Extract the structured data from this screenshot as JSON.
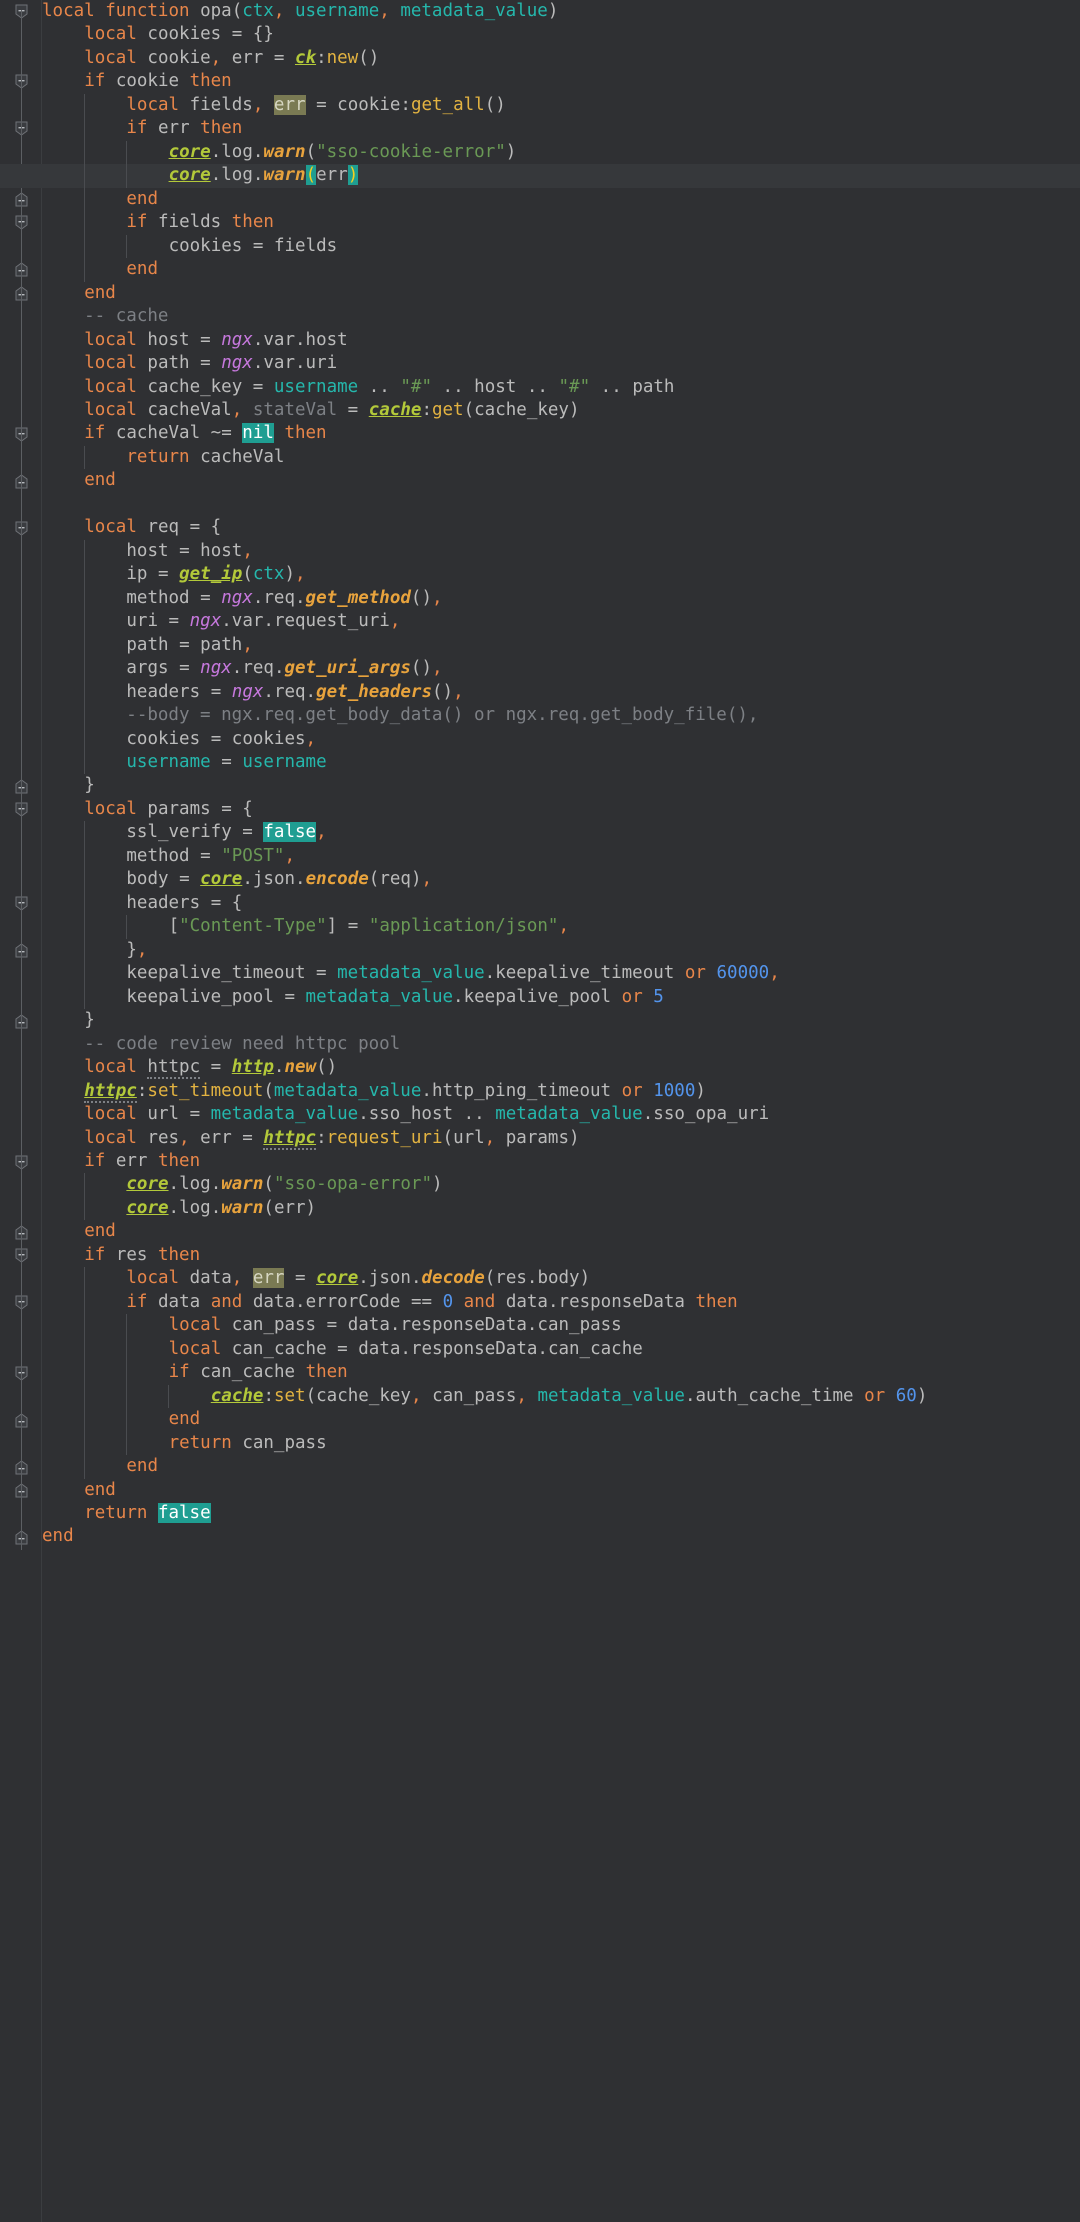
{
  "editor": {
    "language": "lua",
    "theme": "darcula",
    "background": "#2f3033",
    "gutter_background": "#2f3033",
    "default_text_color": "#bbbbbb",
    "cursor_line_color": "#36383b",
    "font_size_px": 17.5,
    "line_height_px": 23.48,
    "tab_width": 4
  },
  "colors": {
    "keyword": "#e8864a",
    "parameter": "#25b7ac",
    "global_italic": "#c678dd",
    "string": "#6a9955",
    "number": "#5394ec",
    "comment": "#7d8085",
    "unused_variable": "#7d8085",
    "method_call": "#e3b341",
    "library_function": "#e8a33d",
    "local_function": "#b3c93a",
    "search_highlight_bg": "#1f9e92",
    "write_usage_bg": "#7a7a53",
    "matching_brace_bg": "#1f9e92",
    "indent_guide": "#4a4c50",
    "fold_marker": "#5c5f63"
  },
  "highlights": {
    "search_term": "false",
    "occurrences": [
      "nil",
      "false"
    ],
    "write_usage_token": "err",
    "cursor_line_numbers": [
      7,
      40
    ]
  },
  "code_lines": [
    {
      "n": 1,
      "indent": 0,
      "fold": "start",
      "text": "local function opa(ctx, username, metadata_value)"
    },
    {
      "n": 2,
      "indent": 1,
      "text": "local cookies = {}"
    },
    {
      "n": 3,
      "indent": 1,
      "text": "local cookie, err = ck:new()"
    },
    {
      "n": 4,
      "indent": 1,
      "fold": "start",
      "text": "if cookie then"
    },
    {
      "n": 5,
      "indent": 2,
      "text": "local fields, err = cookie:get_all()"
    },
    {
      "n": 6,
      "indent": 2,
      "fold": "start",
      "text": "if err then"
    },
    {
      "n": 7,
      "indent": 3,
      "text": "core.log.warn(\"sso-cookie-error\")"
    },
    {
      "n": 8,
      "indent": 3,
      "text": "core.log.warn(err)",
      "cursor": true
    },
    {
      "n": 9,
      "indent": 2,
      "fold": "end",
      "text": "end"
    },
    {
      "n": 10,
      "indent": 2,
      "fold": "start",
      "text": "if fields then"
    },
    {
      "n": 11,
      "indent": 3,
      "text": "cookies = fields"
    },
    {
      "n": 12,
      "indent": 2,
      "fold": "end",
      "text": "end"
    },
    {
      "n": 13,
      "indent": 1,
      "fold": "end",
      "text": "end"
    },
    {
      "n": 14,
      "indent": 1,
      "text": "-- cache"
    },
    {
      "n": 15,
      "indent": 1,
      "text": "local host = ngx.var.host"
    },
    {
      "n": 16,
      "indent": 1,
      "text": "local path = ngx.var.uri"
    },
    {
      "n": 17,
      "indent": 1,
      "text": "local cache_key = username .. \"#\" .. host .. \"#\" .. path"
    },
    {
      "n": 18,
      "indent": 1,
      "text": "local cacheVal, stateVal = cache:get(cache_key)"
    },
    {
      "n": 19,
      "indent": 1,
      "fold": "start",
      "text": "if cacheVal ~= nil then"
    },
    {
      "n": 20,
      "indent": 2,
      "text": "return cacheVal"
    },
    {
      "n": 21,
      "indent": 1,
      "fold": "end",
      "text": "end"
    },
    {
      "n": 22,
      "indent": 0,
      "text": ""
    },
    {
      "n": 23,
      "indent": 1,
      "fold": "start",
      "text": "local req = {"
    },
    {
      "n": 24,
      "indent": 2,
      "text": "host = host,"
    },
    {
      "n": 25,
      "indent": 2,
      "text": "ip = get_ip(ctx),"
    },
    {
      "n": 26,
      "indent": 2,
      "text": "method = ngx.req.get_method(),"
    },
    {
      "n": 27,
      "indent": 2,
      "text": "uri = ngx.var.request_uri,"
    },
    {
      "n": 28,
      "indent": 2,
      "text": "path = path,"
    },
    {
      "n": 29,
      "indent": 2,
      "text": "args = ngx.req.get_uri_args(),"
    },
    {
      "n": 30,
      "indent": 2,
      "text": "headers = ngx.req.get_headers(),"
    },
    {
      "n": 31,
      "indent": 2,
      "text": "--body = ngx.req.get_body_data() or ngx.req.get_body_file(),"
    },
    {
      "n": 32,
      "indent": 2,
      "text": "cookies = cookies,"
    },
    {
      "n": 33,
      "indent": 2,
      "text": "username = username"
    },
    {
      "n": 34,
      "indent": 1,
      "fold": "end",
      "text": "}"
    },
    {
      "n": 35,
      "indent": 1,
      "fold": "start",
      "text": "local params = {"
    },
    {
      "n": 36,
      "indent": 2,
      "text": "ssl_verify = false,"
    },
    {
      "n": 37,
      "indent": 2,
      "text": "method = \"POST\","
    },
    {
      "n": 38,
      "indent": 2,
      "text": "body = core.json.encode(req),"
    },
    {
      "n": 39,
      "indent": 2,
      "fold": "start",
      "text": "headers = {"
    },
    {
      "n": 40,
      "indent": 3,
      "text": "[\"Content-Type\"] = \"application/json\","
    },
    {
      "n": 41,
      "indent": 2,
      "fold": "end",
      "text": "},"
    },
    {
      "n": 42,
      "indent": 2,
      "text": "keepalive_timeout = metadata_value.keepalive_timeout or 60000,"
    },
    {
      "n": 43,
      "indent": 2,
      "text": "keepalive_pool = metadata_value.keepalive_pool or 5"
    },
    {
      "n": 44,
      "indent": 1,
      "fold": "end",
      "text": "}"
    },
    {
      "n": 45,
      "indent": 1,
      "text": "-- code review need httpc pool"
    },
    {
      "n": 46,
      "indent": 1,
      "text": "local httpc = http.new()"
    },
    {
      "n": 47,
      "indent": 1,
      "text": "httpc:set_timeout(metadata_value.http_ping_timeout or 1000)"
    },
    {
      "n": 48,
      "indent": 1,
      "text": "local url = metadata_value.sso_host .. metadata_value.sso_opa_uri"
    },
    {
      "n": 49,
      "indent": 1,
      "text": "local res, err = httpc:request_uri(url, params)"
    },
    {
      "n": 50,
      "indent": 1,
      "fold": "start",
      "text": "if err then"
    },
    {
      "n": 51,
      "indent": 2,
      "text": "core.log.warn(\"sso-opa-error\")"
    },
    {
      "n": 52,
      "indent": 2,
      "text": "core.log.warn(err)"
    },
    {
      "n": 53,
      "indent": 1,
      "fold": "end",
      "text": "end"
    },
    {
      "n": 54,
      "indent": 1,
      "fold": "start",
      "text": "if res then"
    },
    {
      "n": 55,
      "indent": 2,
      "text": "local data, err = core.json.decode(res.body)"
    },
    {
      "n": 56,
      "indent": 2,
      "fold": "start",
      "text": "if data and data.errorCode == 0 and data.responseData then"
    },
    {
      "n": 57,
      "indent": 3,
      "text": "local can_pass = data.responseData.can_pass"
    },
    {
      "n": 58,
      "indent": 3,
      "text": "local can_cache = data.responseData.can_cache"
    },
    {
      "n": 59,
      "indent": 3,
      "fold": "start",
      "text": "if can_cache then"
    },
    {
      "n": 60,
      "indent": 4,
      "text": "cache:set(cache_key, can_pass, metadata_value.auth_cache_time or 60)"
    },
    {
      "n": 61,
      "indent": 3,
      "fold": "end",
      "text": "end"
    },
    {
      "n": 62,
      "indent": 3,
      "text": "return can_pass"
    },
    {
      "n": 63,
      "indent": 2,
      "fold": "end",
      "text": "end"
    },
    {
      "n": 64,
      "indent": 1,
      "fold": "end",
      "text": "end"
    },
    {
      "n": 65,
      "indent": 1,
      "text": "return false"
    },
    {
      "n": 66,
      "indent": 0,
      "fold": "end",
      "text": "end"
    }
  ]
}
